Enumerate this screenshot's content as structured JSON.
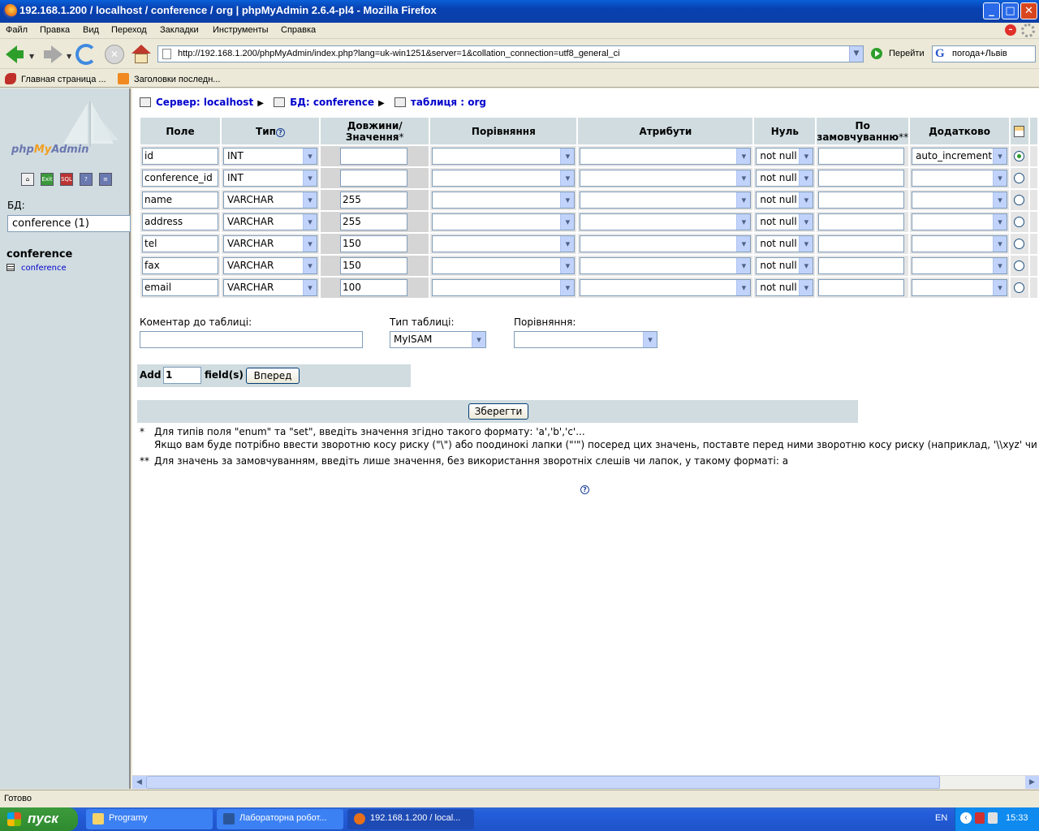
{
  "window": {
    "title": "192.168.1.200 / localhost / conference  / org | phpMyAdmin 2.6.4-pl4 - Mozilla Firefox",
    "minimize": "_",
    "maximize": "□",
    "close": "✕"
  },
  "menu": [
    "Файл",
    "Правка",
    "Вид",
    "Переход",
    "Закладки",
    "Инструменты",
    "Справка"
  ],
  "nav": {
    "url": "http://192.168.1.200/phpMyAdmin/index.php?lang=uk-win1251&server=1&collation_connection=utf8_general_ci",
    "go_label": "Перейти",
    "search_value": "погода+Львів",
    "search_engine_glyph": "G"
  },
  "bookmarks": [
    "Главная страница ...",
    "Заголовки последн..."
  ],
  "sidebar": {
    "logo": {
      "php": "php",
      "my": "My",
      "admin": "Admin"
    },
    "db_label": "БД:",
    "db_select": "conference (1)",
    "db_title": "conference",
    "tables": [
      "conference"
    ]
  },
  "breadcrumb": {
    "server": "Сервер: localhost",
    "db": "БД: conference",
    "table": "таблиця : org"
  },
  "fields_table": {
    "headers": {
      "field": "Поле",
      "type": "Тип",
      "length": "Довжини/Значення",
      "length_mark": "*",
      "collation": "Порівняння",
      "attributes": "Атрибути",
      "null": "Нуль",
      "default_line1": "По",
      "default_line2": "замовчуванню",
      "default_mark": "**",
      "extra": "Додатково"
    },
    "rows": [
      {
        "name": "id",
        "type": "INT",
        "length": "",
        "null": "not null",
        "extra": "auto_increment",
        "primary": true
      },
      {
        "name": "conference_id",
        "type": "INT",
        "length": "",
        "null": "not null",
        "extra": "",
        "primary": false
      },
      {
        "name": "name",
        "type": "VARCHAR",
        "length": "255",
        "null": "not null",
        "extra": "",
        "primary": false
      },
      {
        "name": "address",
        "type": "VARCHAR",
        "length": "255",
        "null": "not null",
        "extra": "",
        "primary": false
      },
      {
        "name": "tel",
        "type": "VARCHAR",
        "length": "150",
        "null": "not null",
        "extra": "",
        "primary": false
      },
      {
        "name": "fax",
        "type": "VARCHAR",
        "length": "150",
        "null": "not null",
        "extra": "",
        "primary": false
      },
      {
        "name": "email",
        "type": "VARCHAR",
        "length": "100",
        "null": "not null",
        "extra": "",
        "primary": false
      }
    ]
  },
  "table_options": {
    "comment_label": "Коментар до таблиці:",
    "comment_value": "",
    "type_label": "Тип таблиці:",
    "type_value": "MyISAM",
    "collation_label": "Порівняння:",
    "collation_value": ""
  },
  "add_fields": {
    "add": "Add",
    "count": "1",
    "fields": "field(s)",
    "go": "Вперед"
  },
  "save_label": "Зберегти",
  "notes": {
    "n1_mark": "*",
    "n1_line1": "Для типів поля \"enum\" та \"set\", введіть значення згідно такого формату: 'a','b','c'...",
    "n1_line2": "Якщо вам буде потрібно ввести зворотню косу риску (\"\\\") або поодинокі лапки (\"'\") посеред цих значень, поставте перед ними зворотню косу риску (наприклад, '\\\\xyz' чи 'a\\'b').",
    "n2_mark": "**",
    "n2": "Для значень за замовчуванням, введіть лише значення, без використання зворотніх слешів чи лапок, у такому форматі: a"
  },
  "status": "Готово",
  "taskbar": {
    "start": "пуск",
    "tasks": [
      {
        "label": "Programy",
        "active": false
      },
      {
        "label": "Лабораторна робот...",
        "active": false
      },
      {
        "label": "192.168.1.200 / local...",
        "active": true
      }
    ],
    "lang": "EN",
    "time": "15:33"
  },
  "colors": {
    "link": "#0000cc",
    "header_bg": "#d0dce0",
    "row_bg": "#e5e5e5",
    "taskbar": "#245edb"
  }
}
